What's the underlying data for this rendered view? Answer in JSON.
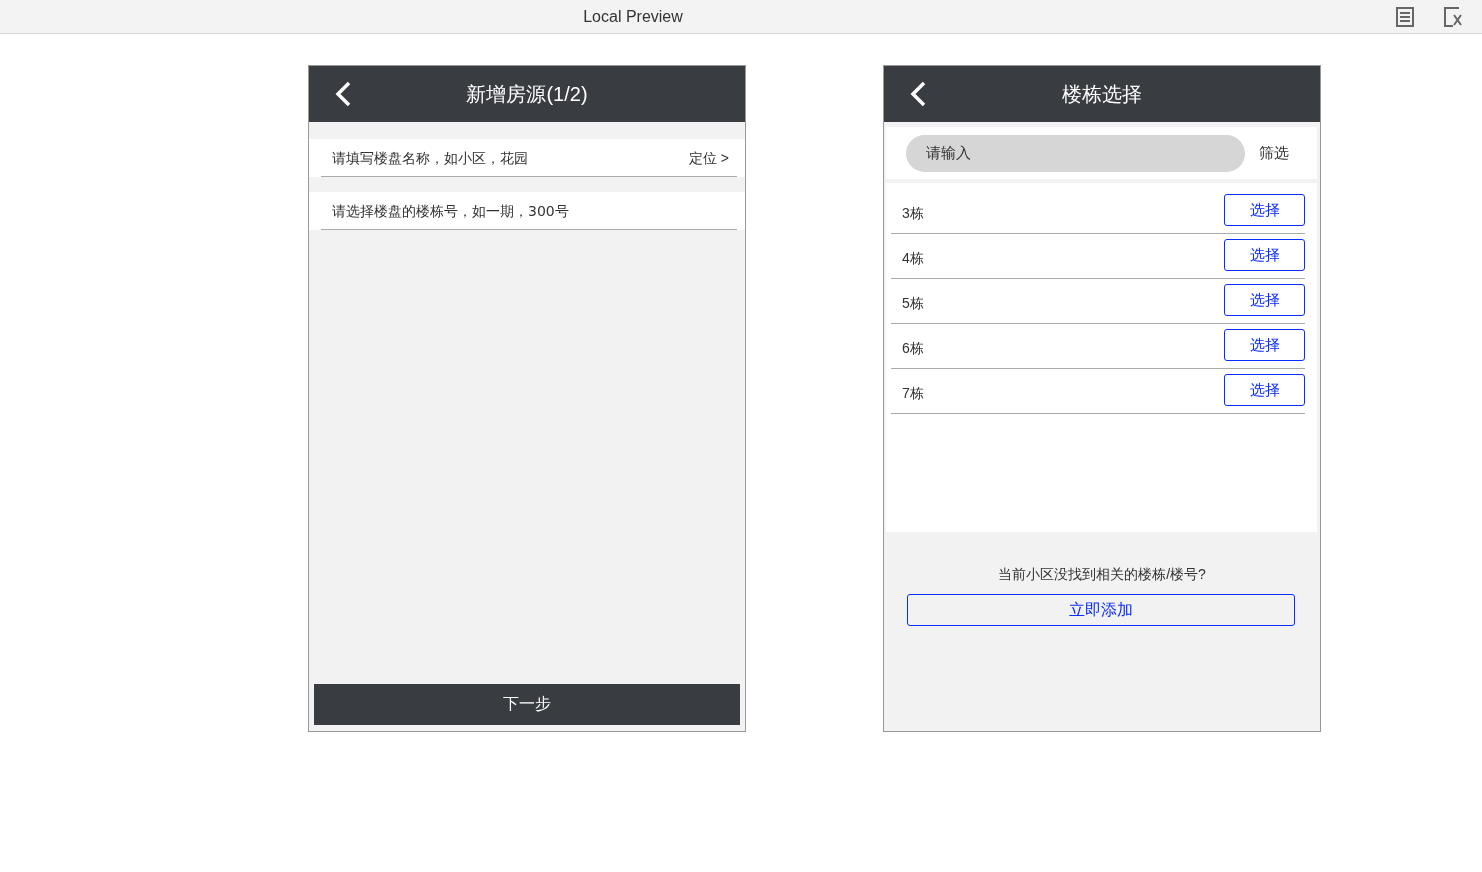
{
  "window": {
    "title": "Local Preview"
  },
  "form_screen": {
    "title": "新增房源(1/2)",
    "fields": [
      {
        "placeholder": "请填写楼盘名称，如小区，花园",
        "action": "定位 >"
      },
      {
        "placeholder": "请选择楼盘的楼栋号，如一期，300号"
      }
    ],
    "next_button": "下一步"
  },
  "building_screen": {
    "title": "楼栋选择",
    "search": {
      "placeholder": "请输入"
    },
    "filter": "筛选",
    "buildings": [
      {
        "name": "3栋",
        "button": "选择"
      },
      {
        "name": "4栋",
        "button": "选择"
      },
      {
        "name": "5栋",
        "button": "选择"
      },
      {
        "name": "6栋",
        "button": "选择"
      },
      {
        "name": "7栋",
        "button": "选择"
      }
    ],
    "missing_prompt": "当前小区没找到相关的楼栋/楼号?",
    "add_button": "立即添加"
  }
}
